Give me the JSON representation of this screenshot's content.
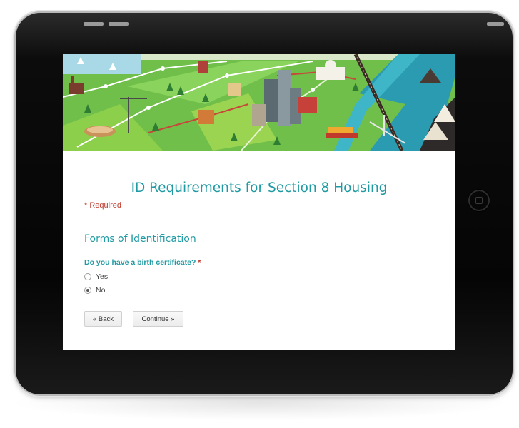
{
  "form": {
    "title": "ID Requirements for Section 8 Housing",
    "required_note": "* Required",
    "section_heading": "Forms of Identification",
    "question": {
      "text": "Do you have a birth certificate?",
      "required_marker": "*",
      "options": [
        {
          "label": "Yes",
          "selected": false
        },
        {
          "label": "No",
          "selected": true
        }
      ]
    },
    "buttons": {
      "back_label": "« Back",
      "continue_label": "Continue »"
    }
  },
  "colors": {
    "accent": "#1f9aa3",
    "required": "#c0392b",
    "banner_green": "#6fbf4a",
    "banner_river": "#2a9bb0"
  }
}
